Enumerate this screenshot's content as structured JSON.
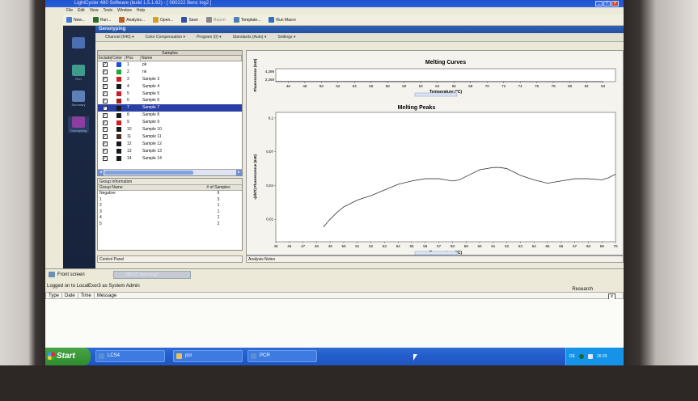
{
  "window": {
    "title": "LightCycler 480 Software (build 1.5.1.62) - [ 080222 Benz Ing2 ]",
    "controls": [
      "_",
      "□",
      "x"
    ]
  },
  "menu": [
    "File",
    "Edit",
    "View",
    "Tools",
    "Window",
    "Help"
  ],
  "toolbar": [
    {
      "label": "New...",
      "color": "#4a7bd0",
      "disabled": false
    },
    {
      "label": "Run...",
      "color": "#2d6c2d",
      "disabled": false
    },
    {
      "label": "Analysis...",
      "color": "#c06020",
      "disabled": false
    },
    {
      "label": "Open...",
      "color": "#d0a030",
      "disabled": false
    },
    {
      "label": "Save",
      "color": "#3050a0",
      "disabled": false
    },
    {
      "label": "Report",
      "color": "#888888",
      "disabled": true
    },
    {
      "label": "Template...",
      "color": "#5080b0",
      "disabled": false
    },
    {
      "label": "Run Macro",
      "color": "#3070c0",
      "disabled": false
    }
  ],
  "sidebar": [
    {
      "label": "",
      "icon": "lightcycler-icon",
      "color": "#4b6fb0"
    },
    {
      "label": "Run",
      "icon": "run-icon",
      "color": "#3f9b8c"
    },
    {
      "label": "Summary",
      "icon": "summary-icon",
      "color": "#5f7fb8"
    },
    {
      "label": "Genotyping",
      "icon": "genotyping-icon",
      "color": "#8a3fa0"
    }
  ],
  "module": {
    "title": "Genotyping"
  },
  "subtoolbar": [
    "Channel (640)",
    "Color Compensation",
    "Program (0)",
    "Standards (Auto)",
    "Settings"
  ],
  "samples": {
    "title": "Samples",
    "headers": [
      "Include",
      "Color",
      "Pos",
      "Name"
    ],
    "selected_index": 6,
    "rows": [
      {
        "pos": "1",
        "name": "pk",
        "color": "#1f4fd6"
      },
      {
        "pos": "2",
        "name": "nk",
        "color": "#21a638"
      },
      {
        "pos": "3",
        "name": "Sample 3",
        "color": "#d01f1f"
      },
      {
        "pos": "4",
        "name": "Sample 4",
        "color": "#1a1a1a"
      },
      {
        "pos": "5",
        "name": "Sample 5",
        "color": "#c41e2a"
      },
      {
        "pos": "6",
        "name": "Sample 6",
        "color": "#b01818"
      },
      {
        "pos": "7",
        "name": "Sample 7",
        "color": "#1a1a1a"
      },
      {
        "pos": "8",
        "name": "Sample 8",
        "color": "#1a1a1a"
      },
      {
        "pos": "9",
        "name": "Sample 9",
        "color": "#d02020"
      },
      {
        "pos": "10",
        "name": "Sample 10",
        "color": "#1a1a1a"
      },
      {
        "pos": "11",
        "name": "Sample 11",
        "color": "#4a2a20"
      },
      {
        "pos": "12",
        "name": "Sample 12",
        "color": "#1a1a1a"
      },
      {
        "pos": "13",
        "name": "Sample 13",
        "color": "#1a1a1a"
      },
      {
        "pos": "14",
        "name": "Sample 14",
        "color": "#1a1a1a"
      }
    ]
  },
  "groups": {
    "title": "Group Information",
    "headers": [
      "Group Name",
      "# of Samples"
    ],
    "rows": [
      {
        "name": "Negative",
        "count": "6"
      },
      {
        "name": "1",
        "count": "3"
      },
      {
        "name": "2",
        "count": "1"
      },
      {
        "name": "3",
        "count": "1"
      },
      {
        "name": "4",
        "count": "1"
      },
      {
        "name": "5",
        "count": "2"
      }
    ]
  },
  "panels": {
    "control": "Control Panel",
    "analysis": "Analysis Notes"
  },
  "chart_data": [
    {
      "type": "line",
      "title": "Melting Curves",
      "xlabel": "Temperature (°C)",
      "ylabel": "Fluorescence (640)",
      "ytick_labels": [
        "4,289",
        "2,269"
      ],
      "xticks": [
        46,
        48,
        50,
        52,
        54,
        56,
        58,
        60,
        62,
        64,
        66,
        68,
        70,
        72,
        74,
        76,
        78,
        80,
        82,
        84
      ],
      "xlim": [
        44.5,
        85.5
      ],
      "ylim": [
        2.269,
        4.289
      ],
      "series": [
        {
          "x": [
            44.5,
            60,
            70,
            80,
            84
          ],
          "y": [
            2.3,
            2.29,
            2.285,
            2.28,
            2.28
          ]
        }
      ]
    },
    {
      "type": "line",
      "title": "Melting Peaks",
      "xlabel": "Temperature (°C)",
      "ylabel": "-(d/dT) Fluorescence (640)",
      "xticks": [
        45,
        46,
        47,
        48,
        49,
        50,
        51,
        52,
        53,
        54,
        55,
        56,
        57,
        58,
        59,
        60,
        61,
        62,
        63,
        64,
        65,
        66,
        67,
        68,
        69,
        70
      ],
      "yticks": [
        0.01,
        0.04,
        0.07,
        0.1
      ],
      "ytick_labels": [
        "0,01",
        "0,04",
        "0,07",
        "0,1"
      ],
      "xlim": [
        45,
        70
      ],
      "ylim": [
        -0.01,
        0.105
      ],
      "grid": false,
      "series": [
        {
          "x": [
            48.5,
            49,
            49.5,
            50,
            51,
            52,
            53,
            54,
            55,
            56,
            57,
            57.5,
            58,
            58.5,
            59,
            60,
            61,
            61.5,
            62,
            63,
            64,
            65,
            66,
            67,
            68,
            69,
            69.5,
            70
          ],
          "y": [
            0.003,
            0.01,
            0.016,
            0.021,
            0.027,
            0.031,
            0.036,
            0.041,
            0.044,
            0.046,
            0.046,
            0.045,
            0.044,
            0.045,
            0.048,
            0.054,
            0.056,
            0.056,
            0.055,
            0.049,
            0.045,
            0.042,
            0.044,
            0.046,
            0.046,
            0.045,
            0.047,
            0.05
          ]
        }
      ]
    }
  ],
  "front": {
    "label": "Front screen",
    "tab": "080222 Benz Ing2"
  },
  "status": {
    "logged": "Logged on to LocalExor3 as System Admin",
    "mode": "Research"
  },
  "log": {
    "headers": [
      "Type",
      "Date",
      "Time",
      "Message"
    ],
    "close": "x"
  },
  "taskbar": {
    "start": "Start",
    "tasks": [
      {
        "label": "LCS4",
        "color": "#5a8fd0"
      },
      {
        "label": "pcr",
        "color": "#e6c25a"
      },
      {
        "label": "PCR",
        "color": "#5a8fd0"
      }
    ],
    "tray": {
      "lang": "DE",
      "time": "16:29"
    }
  }
}
